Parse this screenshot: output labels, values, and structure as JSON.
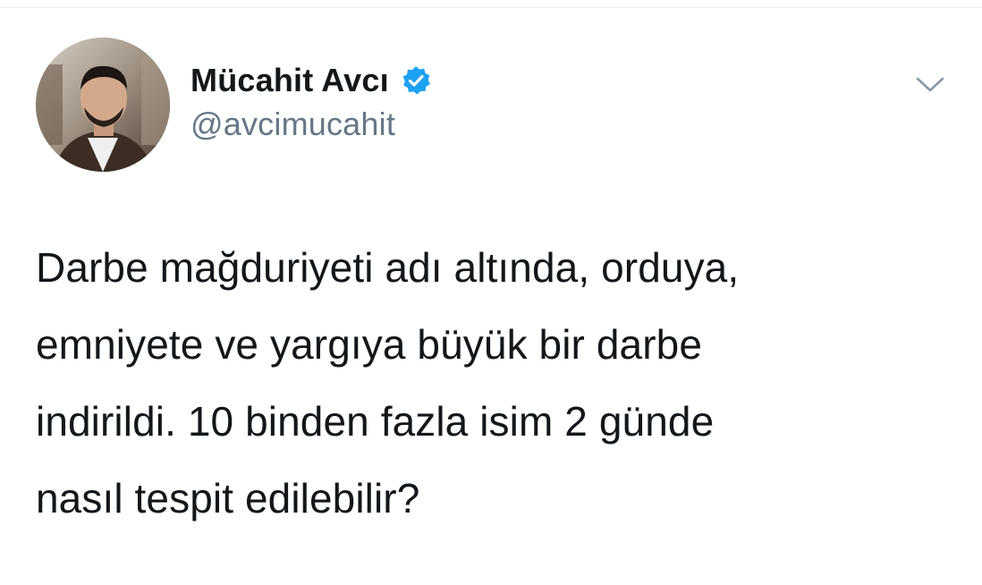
{
  "tweet": {
    "author": {
      "display_name": "Mücahit Avcı",
      "handle": "@avcimucahit",
      "verified": true,
      "avatar_icon": "user-avatar-photo"
    },
    "menu_icon": "chevron-down-icon",
    "text_lines": [
      "Darbe mağduriyeti adı altında, orduya,",
      "emniyete ve yargıya büyük bir darbe",
      "indirildi. 10 binden fazla isim 2 günde",
      "nasıl tespit edilebilir?"
    ]
  },
  "colors": {
    "text_primary": "#14171a",
    "text_secondary": "#657786",
    "verified_blue": "#1da1f2",
    "chevron": "#8899a6",
    "divider": "#e6ecf0"
  }
}
